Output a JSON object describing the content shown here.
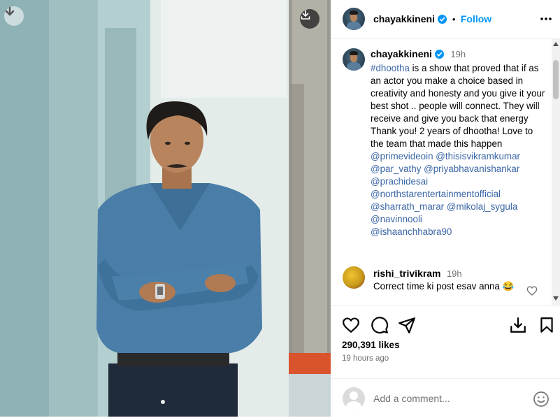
{
  "photo": {
    "download_icon": "download-arrow-icon",
    "save_icon": "download-tray-icon"
  },
  "header": {
    "username": "chayakkineni",
    "separator": "•",
    "follow_label": "Follow",
    "more_icon": "more-horizontal-icon"
  },
  "caption": {
    "username": "chayakkineni",
    "time": "19h",
    "hashtag": "#dhootha",
    "text1": " is a show that proved that if as an actor you make a choice based in creativity and honesty and you give it your best shot .. people will connect. They will receive and give you back that energy",
    "text2": "Thank you! 2 years of dhootha! Love to the team that made this happen",
    "mentions": [
      "@primevideoin",
      "@thisisvikramkumar",
      "@par_vathy",
      "@priyabhavanishankar",
      "@prachidesai",
      "@northstarentertainmentofficial",
      "@sharrath_marar",
      "@mikolaj_sygula",
      "@navinnooli",
      "@ishaanchhabra90"
    ]
  },
  "comment": {
    "username": "rishi_trivikram",
    "time": "19h",
    "text": "Correct time ki post esav anna 😂",
    "emoji2": "😂"
  },
  "actions": {
    "likes": "290,391 likes",
    "ago": "19 hours ago"
  },
  "comment_box": {
    "placeholder": "Add a comment..."
  },
  "colors": {
    "link": "#0095f6",
    "mention": "#3b66a6",
    "secondary": "#737373"
  }
}
